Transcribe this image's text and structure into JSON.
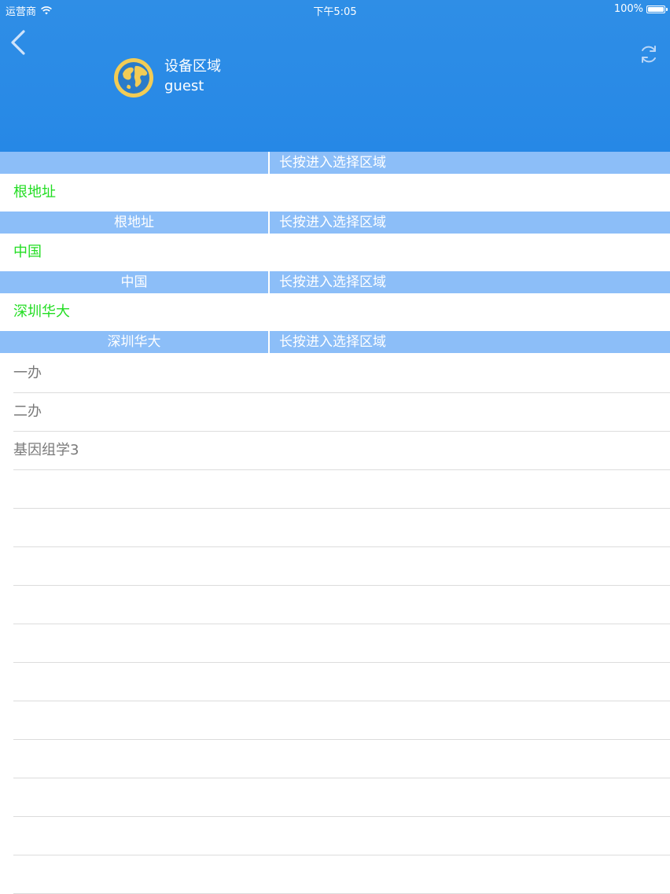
{
  "statusbar": {
    "carrier": "运营商",
    "time": "下午5:05",
    "battery": "100%"
  },
  "header": {
    "title": "设备区域",
    "subtitle": "guest",
    "icons": [
      "back-chevron-icon",
      "globe-icon",
      "refresh-icon"
    ]
  },
  "levels": [
    {
      "crumb": null,
      "band_left": "",
      "band_right": "长按进入选择区域"
    },
    {
      "crumb": "根地址",
      "band_left": "根地址",
      "band_right": "长按进入选择区域"
    },
    {
      "crumb": "中国",
      "band_left": "中国",
      "band_right": "长按进入选择区域"
    },
    {
      "crumb": "深圳华大",
      "band_left": "深圳华大",
      "band_right": "长按进入选择区域"
    }
  ],
  "areas": [
    "一办",
    "二办",
    "基因组学3",
    "",
    "",
    "",
    "",
    "",
    "",
    "",
    "",
    "",
    "",
    ""
  ],
  "colors": {
    "header_bg": "#2688e6",
    "band_bg": "#8cbef8",
    "crumb_text": "#22dd22",
    "list_text": "#7a7a7a"
  }
}
